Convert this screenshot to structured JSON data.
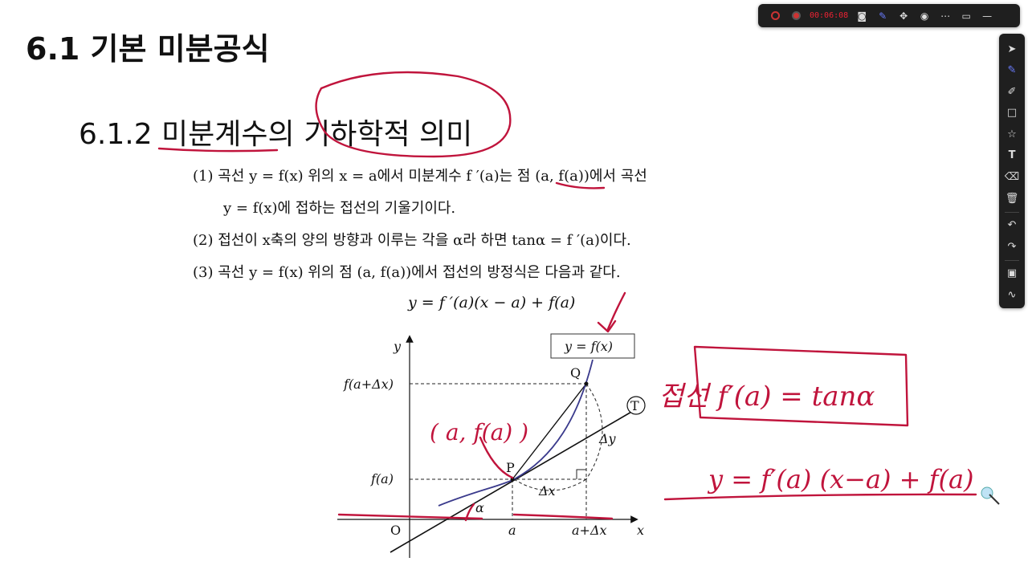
{
  "slide": {
    "main_title": "6.1 기본 미분공식",
    "subtitle": "6.1.2 미분계수의 기하학적 의미",
    "items": [
      {
        "num": "(1)",
        "text": "곡선 y = f(x) 위의 x = a에서 미분계수 f ′(a)는 점 (a, f(a))에서 곡선"
      },
      {
        "num": "",
        "text": "y = f(x)에 접하는 접선의 기울기이다."
      },
      {
        "num": "(2)",
        "text": "접선이 x축의 양의 방향과 이루는 각을 α라 하면 tanα = f ′(a)이다."
      },
      {
        "num": "(3)",
        "text": "곡선 y = f(x) 위의 점 (a, f(a))에서 접선의 방정식은 다음과 같다."
      }
    ],
    "tangent_formula": "y = f ′(a)(x − a) + f(a)"
  },
  "graph": {
    "y_axis": "y",
    "x_axis": "x",
    "origin": "O",
    "curve_label": "y = f(x)",
    "fa_plus": "f(a+Δx)",
    "fa": "f(a)",
    "point_q": "Q",
    "point_p": "P",
    "point_t": "T",
    "delta_y": "Δy",
    "delta_x": "Δx",
    "alpha": "α",
    "tick_a": "a",
    "tick_a_plus": "a+Δx"
  },
  "handwriting": {
    "point_note": "( a, f(a) )",
    "slope_note": "접선 f′(a) = tanα",
    "equation_note": "y = f′(a) (x−a) + f(a)"
  },
  "recorder": {
    "timer": "00:06:08",
    "accent_color": "#e02020"
  },
  "tools": [
    "select-icon",
    "pen-icon",
    "highlighter-icon",
    "rectangle-icon",
    "star-icon",
    "text-icon",
    "eraser-icon",
    "trash-icon",
    "undo-icon",
    "redo-icon",
    "screenshot-icon",
    "signature-icon"
  ],
  "colors": {
    "ink": "#c0143c",
    "curve": "#3a3a8c",
    "pen_active": "#6a7cff"
  }
}
